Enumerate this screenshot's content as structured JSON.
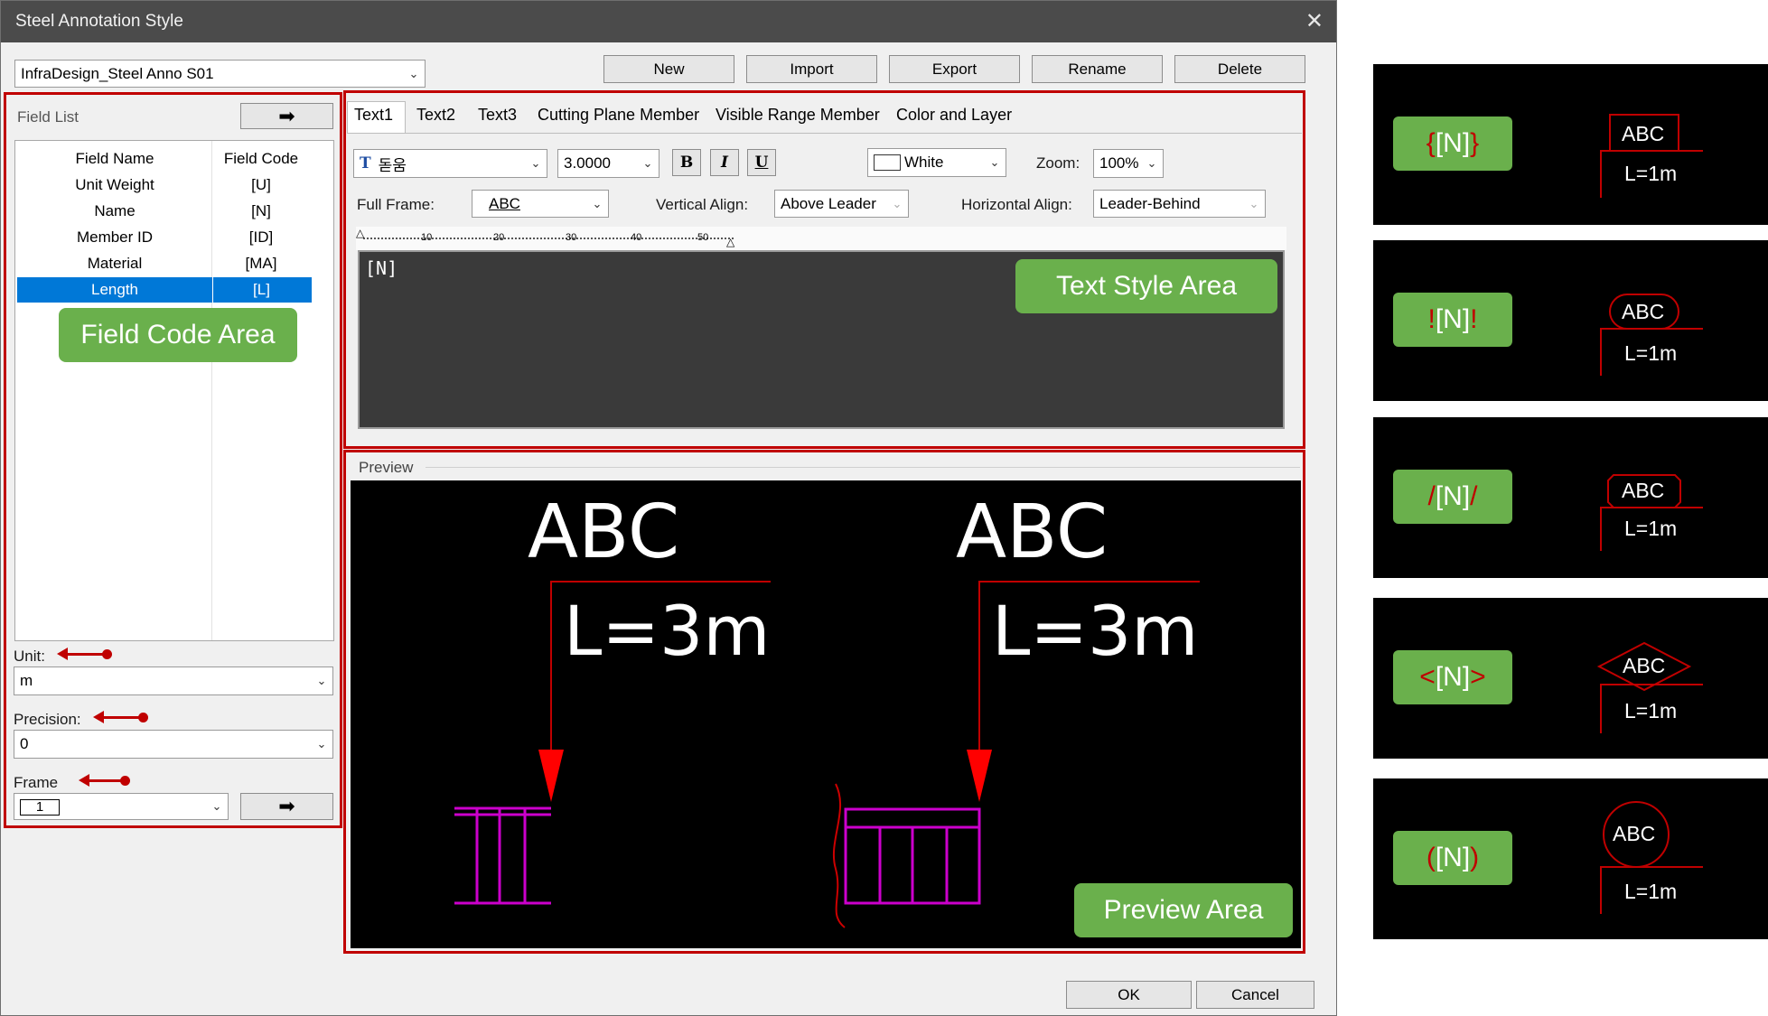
{
  "window": {
    "title": "Steel Annotation Style",
    "close_glyph": "✕"
  },
  "style_selector": {
    "value": "InfraDesign_Steel Anno S01"
  },
  "toolbar": {
    "new": "New",
    "import": "Import",
    "export": "Export",
    "rename": "Rename",
    "delete": "Delete"
  },
  "field_list": {
    "title": "Field List",
    "headers": {
      "name": "Field Name",
      "code": "Field Code"
    },
    "rows": [
      {
        "name": "Unit Weight",
        "code": "[U]"
      },
      {
        "name": "Name",
        "code": "[N]"
      },
      {
        "name": "Member ID",
        "code": "[ID]"
      },
      {
        "name": "Material",
        "code": "[MA]"
      },
      {
        "name": "Length",
        "code": "[L]"
      }
    ],
    "selected_row": "Length"
  },
  "callouts": {
    "field_code_area": "Field Code Area",
    "text_style_area": "Text Style Area",
    "preview_area": "Preview Area"
  },
  "unit": {
    "label": "Unit:",
    "value": "m"
  },
  "precision": {
    "label": "Precision:",
    "value": "0"
  },
  "frame": {
    "label": "Frame",
    "value": "1"
  },
  "tabs": [
    "Text1",
    "Text2",
    "Text3",
    "Cutting Plane Member",
    "Visible Range Member",
    "Color and Layer"
  ],
  "active_tab": "Text1",
  "text_style": {
    "font": "돋움",
    "size": "3.0000",
    "bold": "B",
    "italic": "I",
    "underline": "U",
    "color": "White",
    "zoom_label": "Zoom:",
    "zoom": "100%",
    "full_frame_label": "Full Frame:",
    "full_frame": "ABC",
    "valign_label": "Vertical Align:",
    "valign": "Above Leader",
    "halign_label": "Horizontal Align:",
    "halign": "Leader-Behind",
    "ruler_marks": [
      "10",
      "20",
      "30",
      "40",
      "50"
    ],
    "editor_text": "[N]"
  },
  "preview": {
    "label": "Preview",
    "left": {
      "top": "ABC",
      "bottom": "L=3m"
    },
    "right": {
      "top": "ABC",
      "bottom": "L=3m"
    }
  },
  "buttons": {
    "ok": "OK",
    "cancel": "Cancel"
  },
  "samples": [
    {
      "open": "{",
      "code": "[N]",
      "close": "}",
      "frame": "rectangle",
      "top": "ABC",
      "bottom": "L=1m"
    },
    {
      "open": "!",
      "code": "[N]",
      "close": "!",
      "frame": "rounded",
      "top": "ABC",
      "bottom": "L=1m"
    },
    {
      "open": "/",
      "code": "[N]",
      "close": "/",
      "frame": "chamfered",
      "top": "ABC",
      "bottom": "L=1m"
    },
    {
      "open": "<",
      "code": "[N]",
      "close": ">",
      "frame": "diamond",
      "top": "ABC",
      "bottom": "L=1m"
    },
    {
      "open": "(",
      "code": "[N]",
      "close": ")",
      "frame": "circle",
      "top": "ABC",
      "bottom": "L=1m"
    }
  ],
  "colors": {
    "frame_red": "#c00000",
    "callout_green": "#6ab04c",
    "selection_blue": "#0078d7",
    "preview_bg": "#000000",
    "steel_magenta": "#cc00cc"
  }
}
